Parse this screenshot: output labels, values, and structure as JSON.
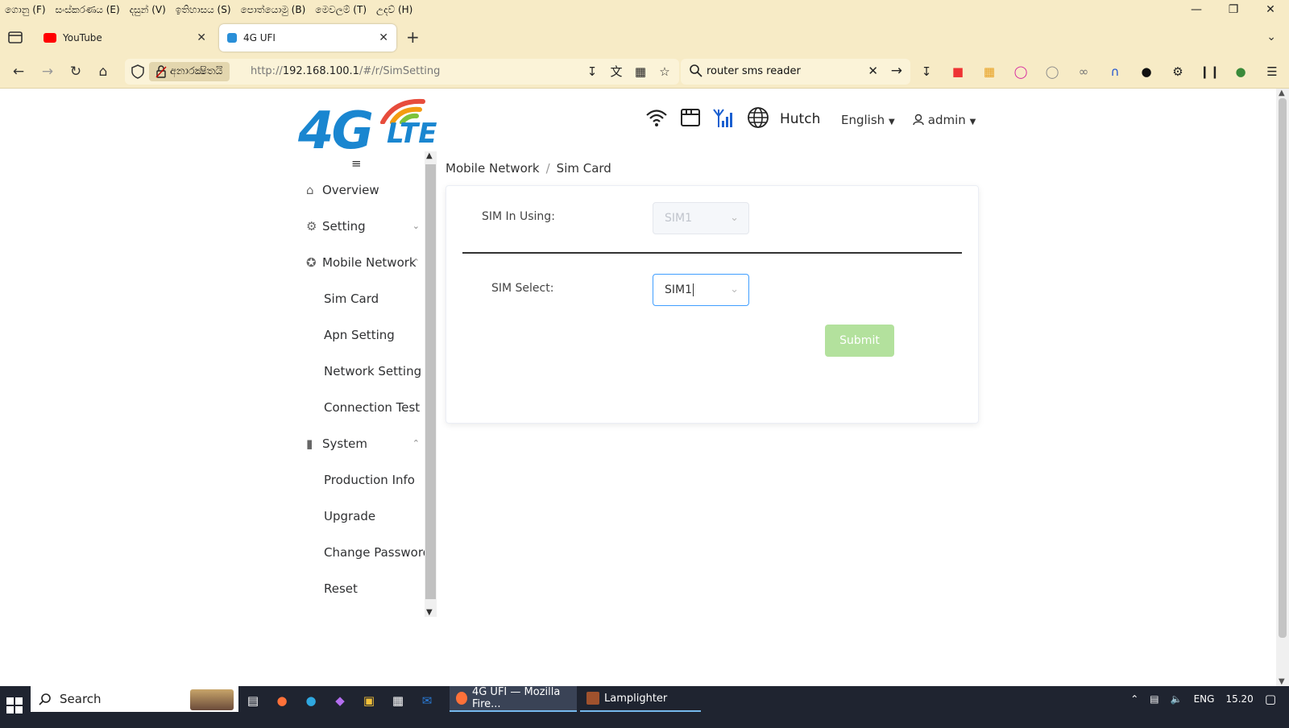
{
  "browser": {
    "menu": [
      "ගොනු (F)",
      "සංස්කරණය (E)",
      "දසුන් (V)",
      "ඉතිහාසය (S)",
      "පොත්යොමු (B)",
      "මෙවලම් (T)",
      "උදව් (H)"
    ],
    "tabs": [
      {
        "label": "YouTube",
        "active": false,
        "favicon_color": "#ff0000"
      },
      {
        "label": "4G UFI",
        "active": true,
        "favicon_color": "#2a8fd8"
      }
    ],
    "security_label": "අනාරක්‍ෂිතයි",
    "url_prefix": "http://",
    "url_host": "192.168.100.1",
    "url_path": "/#/r/SimSetting",
    "search_text": "router sms reader"
  },
  "header": {
    "logo_main": "4G",
    "logo_sub": "LTE",
    "operator": "Hutch",
    "language": "English",
    "user": "admin",
    "signal_color": "#1a5fd0"
  },
  "sidebar": {
    "items": [
      {
        "label": "Overview",
        "icon": "home-icon"
      },
      {
        "label": "Setting",
        "icon": "gear-icon",
        "expanded": false
      },
      {
        "label": "Mobile Network",
        "icon": "antenna-icon",
        "expanded": true
      },
      {
        "label": "System",
        "icon": "system-icon",
        "expanded": true
      }
    ],
    "mobile_network_sub": [
      "Sim Card",
      "Apn Setting",
      "Network Setting",
      "Connection Test"
    ],
    "system_sub": [
      "Production Info",
      "Upgrade",
      "Change Password",
      "Reset"
    ]
  },
  "breadcrumb": {
    "parent": "Mobile Network",
    "separator": "/",
    "current": "Sim Card"
  },
  "form": {
    "sim_in_using_label": "SIM In Using:",
    "sim_in_using_value": "SIM1",
    "sim_select_label": "SIM Select:",
    "sim_select_value": "SIM1",
    "submit_label": "Submit"
  },
  "taskbar": {
    "search_text": "Search",
    "apps": [
      {
        "label": "4G UFI — Mozilla Fire...",
        "active": true
      },
      {
        "label": "Lamplighter",
        "active": false
      }
    ],
    "lang": "ENG",
    "time": "15.20"
  }
}
